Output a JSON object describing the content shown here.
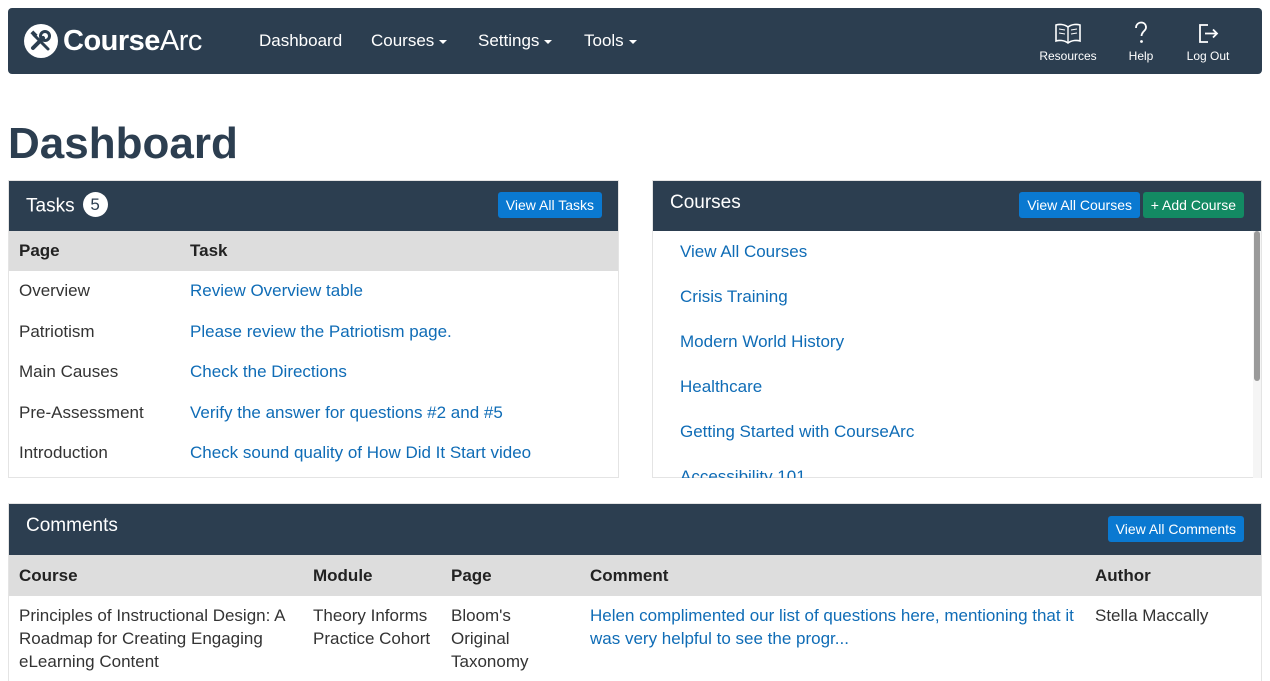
{
  "brand": {
    "bold": "Course",
    "light": "Arc"
  },
  "nav": {
    "items": [
      {
        "label": "Dashboard",
        "dropdown": false
      },
      {
        "label": "Courses",
        "dropdown": true
      },
      {
        "label": "Settings",
        "dropdown": true
      },
      {
        "label": "Tools",
        "dropdown": true
      }
    ],
    "icons": [
      {
        "label": "Resources",
        "icon": "book-icon"
      },
      {
        "label": "Help",
        "icon": "question-icon"
      },
      {
        "label": "Log Out",
        "icon": "logout-icon"
      }
    ]
  },
  "page_title": "Dashboard",
  "tasks": {
    "title": "Tasks",
    "count": "5",
    "view_all_label": "View All Tasks",
    "columns": [
      "Page",
      "Task"
    ],
    "rows": [
      {
        "page": "Overview",
        "task": "Review Overview table"
      },
      {
        "page": "Patriotism",
        "task": "Please review the Patriotism page."
      },
      {
        "page": "Main Causes",
        "task": "Check the Directions"
      },
      {
        "page": "Pre-Assessment",
        "task": "Verify the answer for questions #2 and #5"
      },
      {
        "page": "Introduction",
        "task": "Check sound quality of How Did It Start video"
      }
    ]
  },
  "courses": {
    "title": "Courses",
    "view_all_label": "View All Courses",
    "add_label": "+ Add Course",
    "items": [
      "View All Courses",
      "Crisis Training",
      "Modern World History",
      "Healthcare",
      "Getting Started with CourseArc",
      "Accessibility 101"
    ]
  },
  "comments": {
    "title": "Comments",
    "view_all_label": "View All Comments",
    "columns": [
      "Course",
      "Module",
      "Page",
      "Comment",
      "Author"
    ],
    "rows": [
      {
        "course": "Principles of Instructional Design: A Roadmap for Creating Engaging eLearning Content",
        "module": "Theory Informs Practice Cohort",
        "page": "Bloom's Original Taxonomy",
        "comment": "Helen complimented our list of questions here, mentioning that it was very helpful to see the progr...",
        "author": "Stella Maccally"
      }
    ]
  },
  "colors": {
    "navbar": "#2c3e50",
    "primary_button": "#0a79d1",
    "success_button": "#138a63",
    "link": "#0f6cb6",
    "table_header": "#dddddd"
  }
}
